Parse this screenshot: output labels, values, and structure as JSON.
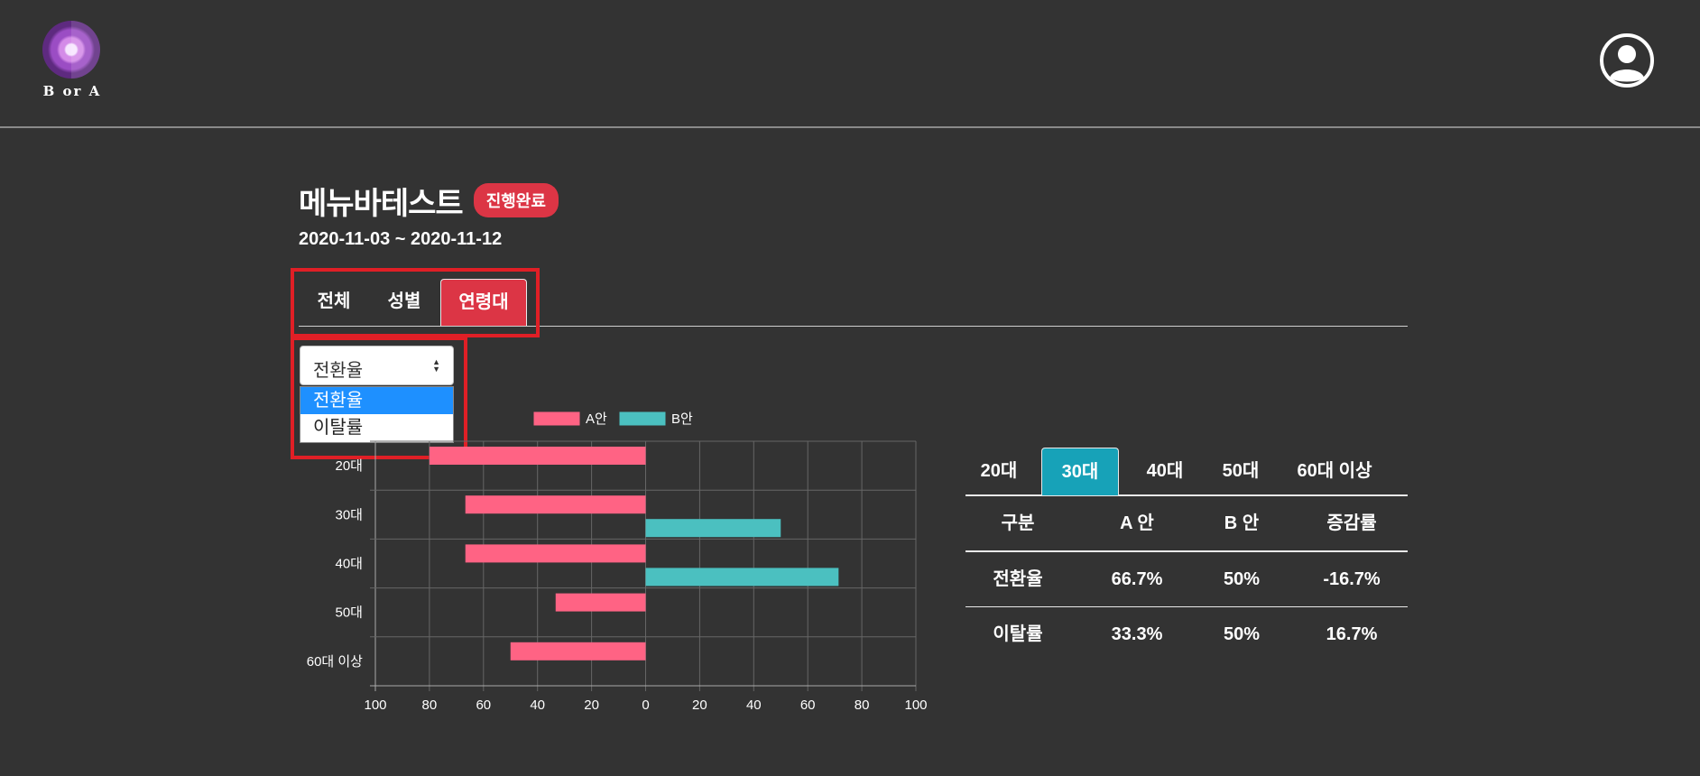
{
  "header": {
    "logo_text": "B or A",
    "logo_icon": "logo-icon",
    "user_icon": "user-circle-icon"
  },
  "test": {
    "title": "메뉴바테스트",
    "status": "진행완료",
    "date_range": "2020-11-03 ~ 2020-11-12"
  },
  "main_tabs": [
    "전체",
    "성별",
    "연령대"
  ],
  "main_tabs_active": "연령대",
  "metric_select": {
    "value": "전환율",
    "options": [
      "전환율",
      "이탈률"
    ]
  },
  "chart_data": {
    "type": "bar",
    "orientation": "horizontal",
    "categories": [
      "20대",
      "30대",
      "40대",
      "50대",
      "60대 이상"
    ],
    "series": [
      {
        "name": "A안",
        "color": "#ff6384",
        "values": [
          80,
          66.7,
          66.7,
          33.3,
          50
        ],
        "direction": "left"
      },
      {
        "name": "B안",
        "color": "#4bc0c0",
        "values": [
          0,
          50,
          71.4,
          0,
          0
        ],
        "direction": "right"
      }
    ],
    "x_ticks": [
      "100",
      "80",
      "60",
      "40",
      "20",
      "0",
      "20",
      "40",
      "60",
      "80",
      "100"
    ],
    "xlim": [
      -100,
      100
    ],
    "grid": true,
    "legend": "top"
  },
  "age_tabs": [
    "20대",
    "30대",
    "40대",
    "50대",
    "60대 이상"
  ],
  "age_tabs_active": "30대",
  "stats_table": {
    "headers": [
      "구분",
      "A 안",
      "B 안",
      "증감률"
    ],
    "rows": [
      [
        "전환율",
        "66.7%",
        "50%",
        "-16.7%"
      ],
      [
        "이탈률",
        "33.3%",
        "50%",
        "16.7%"
      ]
    ]
  },
  "colors": {
    "background": "#333333",
    "badge": "#dc3545",
    "active_tab": "#dc3545",
    "active_age_tab": "#17a2b8",
    "highlight_box": "#e01f26",
    "series_a": "#ff6384",
    "series_b": "#4bc0c0"
  }
}
